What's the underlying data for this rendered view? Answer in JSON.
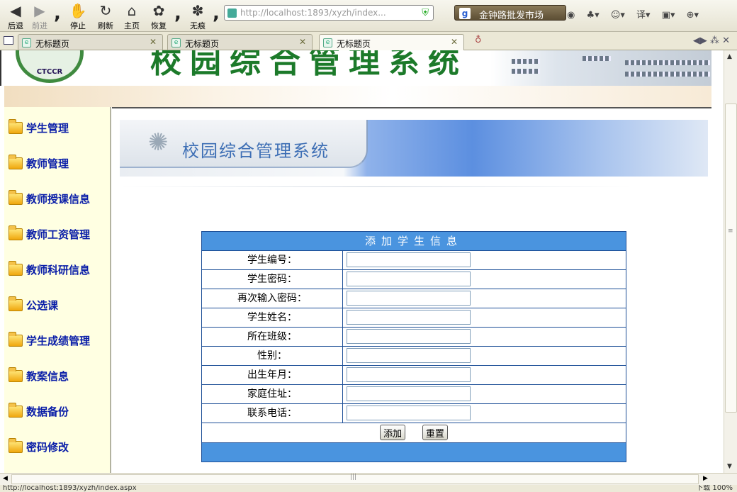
{
  "browser": {
    "toolbar": {
      "back_label": "后退",
      "forward_label": "前进",
      "stop_label": "停止",
      "refresh_label": "刷新",
      "home_label": "主页",
      "restore_label": "恢复",
      "private_label": "无痕"
    },
    "url": "http://localhost:1893/xyzh/index...",
    "search_text": "金钟路批发市场",
    "tabs": [
      {
        "title": "无标题页"
      },
      {
        "title": "无标题页"
      },
      {
        "title": "无标题页"
      }
    ],
    "status_text": "http://localhost:1893/xyzh/index.aspx",
    "status_right": "下载  100%"
  },
  "banner": {
    "logo_text": "CTCCR",
    "title": "校园综合管理系统"
  },
  "sidebar": {
    "items": [
      {
        "label": "学生管理"
      },
      {
        "label": "教师管理"
      },
      {
        "label": "教师授课信息"
      },
      {
        "label": "教师工资管理"
      },
      {
        "label": "教师科研信息"
      },
      {
        "label": "公选课"
      },
      {
        "label": "学生成绩管理"
      },
      {
        "label": "教案信息"
      },
      {
        "label": "数据备份"
      },
      {
        "label": "密码修改"
      }
    ]
  },
  "content": {
    "system_title": "校园综合管理系统",
    "form": {
      "title": "添加学生信息",
      "fields": [
        {
          "label": "学生编号：",
          "value": ""
        },
        {
          "label": "学生密码：",
          "value": ""
        },
        {
          "label": "再次输入密码：",
          "value": ""
        },
        {
          "label": "学生姓名：",
          "value": ""
        },
        {
          "label": "所在班级：",
          "value": ""
        },
        {
          "label": "性别：",
          "value": ""
        },
        {
          "label": "出生年月：",
          "value": ""
        },
        {
          "label": "家庭住址：",
          "value": ""
        },
        {
          "label": "联系电话：",
          "value": ""
        }
      ],
      "add_label": "添加",
      "reset_label": "重置"
    }
  },
  "colors": {
    "form_header": "#4a94df",
    "form_border": "#1d4f97",
    "nav_text": "#0a1ea8",
    "sidebar_bg": "#ffffe2"
  }
}
